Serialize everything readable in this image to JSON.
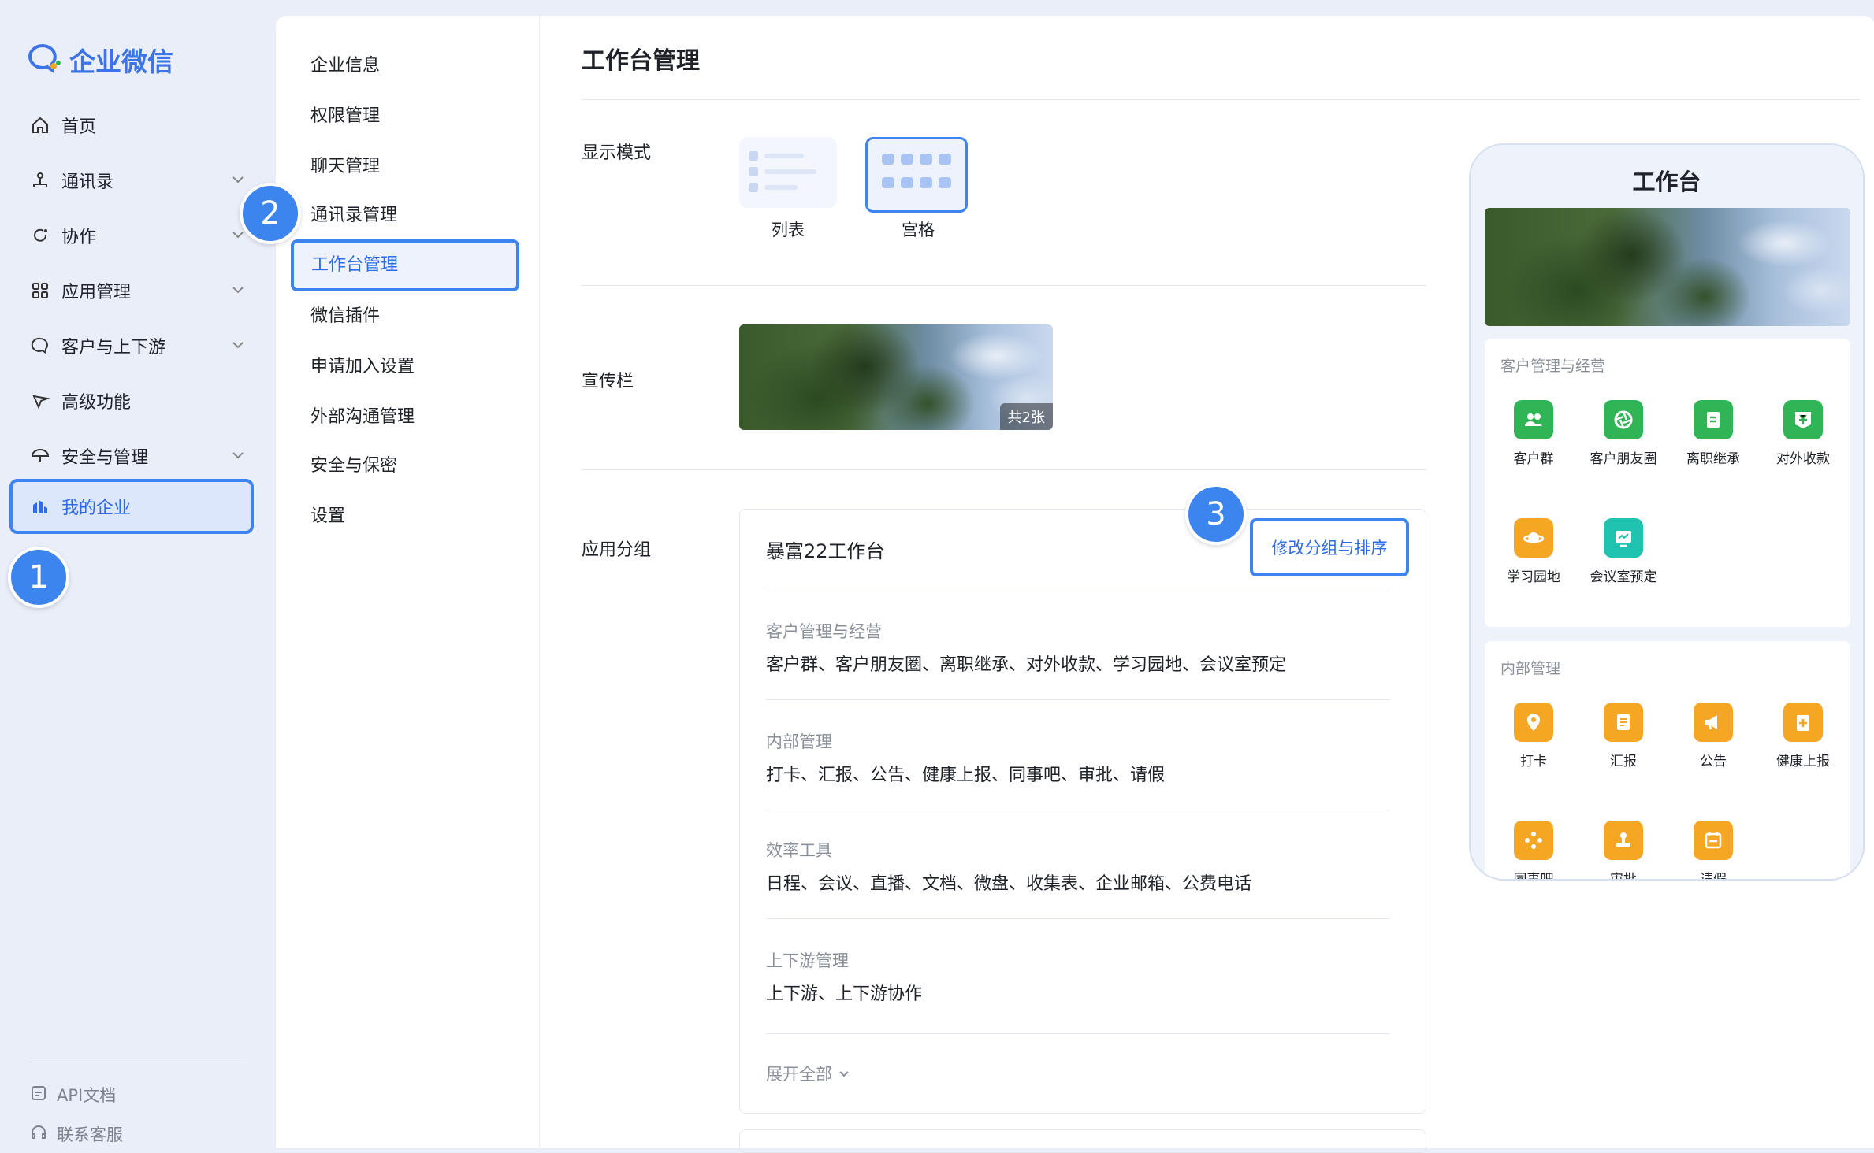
{
  "brand": {
    "name": "企业微信"
  },
  "nav": {
    "items": [
      {
        "label": "首页",
        "icon": "home-icon"
      },
      {
        "label": "通讯录",
        "icon": "org-chart-icon"
      },
      {
        "label": "协作",
        "icon": "collab-icon"
      },
      {
        "label": "应用管理",
        "icon": "apps-grid-icon"
      },
      {
        "label": "客户与上下游",
        "icon": "chat-bubble-icon"
      },
      {
        "label": "高级功能",
        "icon": "sparkle-icon"
      },
      {
        "label": "安全与管理",
        "icon": "umbrella-icon"
      },
      {
        "label": "我的企业",
        "icon": "company-icon"
      }
    ],
    "active": "我的企业",
    "bottom": [
      {
        "label": "API文档",
        "icon": "api-doc-icon"
      },
      {
        "label": "联系客服",
        "icon": "headset-icon"
      }
    ]
  },
  "markers": [
    "1",
    "2",
    "3"
  ],
  "submenu": {
    "items": [
      "企业信息",
      "权限管理",
      "聊天管理",
      "通讯录管理",
      "工作台管理",
      "微信插件",
      "申请加入设置",
      "外部沟通管理",
      "安全与保密",
      "设置"
    ],
    "active": "工作台管理"
  },
  "main": {
    "title": "工作台管理",
    "display_mode": {
      "label": "显示模式",
      "options": [
        "列表",
        "宫格"
      ],
      "selected": "宫格"
    },
    "banner": {
      "label": "宣传栏",
      "count_badge": "共2张"
    },
    "app_group": {
      "label": "应用分组",
      "card_title": "暴富22工作台",
      "edit_button": "修改分组与排序",
      "groups": [
        {
          "name": "客户管理与经营",
          "apps": "客户群、客户朋友圈、离职继承、对外收款、学习园地、会议室预定"
        },
        {
          "name": "内部管理",
          "apps": "打卡、汇报、公告、健康上报、同事吧、审批、请假"
        },
        {
          "name": "效率工具",
          "apps": "日程、会议、直播、文档、微盘、收集表、企业邮箱、公费电话"
        },
        {
          "name": "上下游管理",
          "apps": "上下游、上下游协作"
        }
      ],
      "expand_all": "展开全部"
    }
  },
  "phone": {
    "title": "工作台",
    "groups": [
      {
        "name": "客户管理与经营",
        "apps": [
          {
            "name": "客户群",
            "icon": "customer-group-icon",
            "color": "#2fb556"
          },
          {
            "name": "客户朋友圈",
            "icon": "moments-icon",
            "color": "#2fb556"
          },
          {
            "name": "离职继承",
            "icon": "transfer-icon",
            "color": "#2fb556"
          },
          {
            "name": "对外收款",
            "icon": "payment-icon",
            "color": "#2fb556"
          },
          {
            "name": "学习园地",
            "icon": "planet-icon",
            "color": "#f5a623"
          },
          {
            "name": "会议室预定",
            "icon": "meeting-room-icon",
            "color": "#1fc3b0"
          }
        ]
      },
      {
        "name": "内部管理",
        "apps": [
          {
            "name": "打卡",
            "icon": "location-pin-icon",
            "color": "#f5a623"
          },
          {
            "name": "汇报",
            "icon": "report-icon",
            "color": "#f5a623"
          },
          {
            "name": "公告",
            "icon": "megaphone-icon",
            "color": "#f5a623"
          },
          {
            "name": "健康上报",
            "icon": "health-report-icon",
            "color": "#f5a623"
          },
          {
            "name": "同事吧",
            "icon": "colleague-icon",
            "color": "#f5a623"
          },
          {
            "name": "审批",
            "icon": "approval-stamp-icon",
            "color": "#f5a623"
          },
          {
            "name": "请假",
            "icon": "calendar-leave-icon",
            "color": "#f5a623"
          }
        ]
      }
    ]
  }
}
